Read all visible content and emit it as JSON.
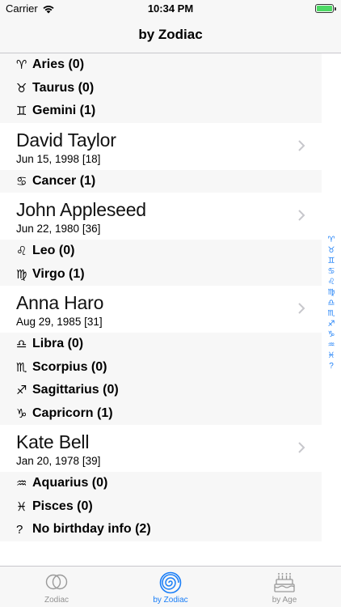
{
  "status_bar": {
    "carrier": "Carrier",
    "time": "10:34 PM"
  },
  "nav": {
    "title": "by Zodiac"
  },
  "rows": [
    {
      "kind": "section",
      "symbol": "♈",
      "label": "Aries (0)"
    },
    {
      "kind": "section",
      "symbol": "♉",
      "label": "Taurus (0)"
    },
    {
      "kind": "section",
      "symbol": "♊",
      "label": "Gemini (1)"
    },
    {
      "kind": "contact",
      "name": "David Taylor",
      "sub": "Jun 15, 1998 [18]"
    },
    {
      "kind": "section",
      "symbol": "♋",
      "label": "Cancer (1)"
    },
    {
      "kind": "contact",
      "name": "John Appleseed",
      "sub": "Jun 22, 1980 [36]"
    },
    {
      "kind": "section",
      "symbol": "♌",
      "label": "Leo (0)"
    },
    {
      "kind": "section",
      "symbol": "♍",
      "label": "Virgo (1)"
    },
    {
      "kind": "contact",
      "name": "Anna Haro",
      "sub": "Aug 29, 1985 [31]"
    },
    {
      "kind": "section",
      "symbol": "♎",
      "label": "Libra (0)"
    },
    {
      "kind": "section",
      "symbol": "♏",
      "label": "Scorpius (0)"
    },
    {
      "kind": "section",
      "symbol": "♐",
      "label": "Sagittarius (0)"
    },
    {
      "kind": "section",
      "symbol": "♑",
      "label": "Capricorn (1)"
    },
    {
      "kind": "contact",
      "name": "Kate Bell",
      "sub": "Jan 20, 1978 [39]"
    },
    {
      "kind": "section",
      "symbol": "♒",
      "label": "Aquarius (0)"
    },
    {
      "kind": "section",
      "symbol": "♓",
      "label": "Pisces (0)"
    },
    {
      "kind": "section",
      "symbol": "?",
      "label": "No birthday info (2)"
    }
  ],
  "index_items": [
    "♈",
    "♉",
    "♊",
    "♋",
    "♌",
    "♍",
    "♎",
    "♏",
    "♐",
    "♑",
    "♒",
    "♓",
    "?"
  ],
  "tabs": [
    {
      "label": "Zodiac",
      "icon": "venn-circles-icon",
      "active": false
    },
    {
      "label": "by Zodiac",
      "icon": "spiral-icon",
      "active": true
    },
    {
      "label": "by Age",
      "icon": "birthday-cake-icon",
      "active": false
    }
  ],
  "colors": {
    "accent": "#1a7ef7",
    "battery": "#4cd964",
    "inactive": "#929292"
  }
}
